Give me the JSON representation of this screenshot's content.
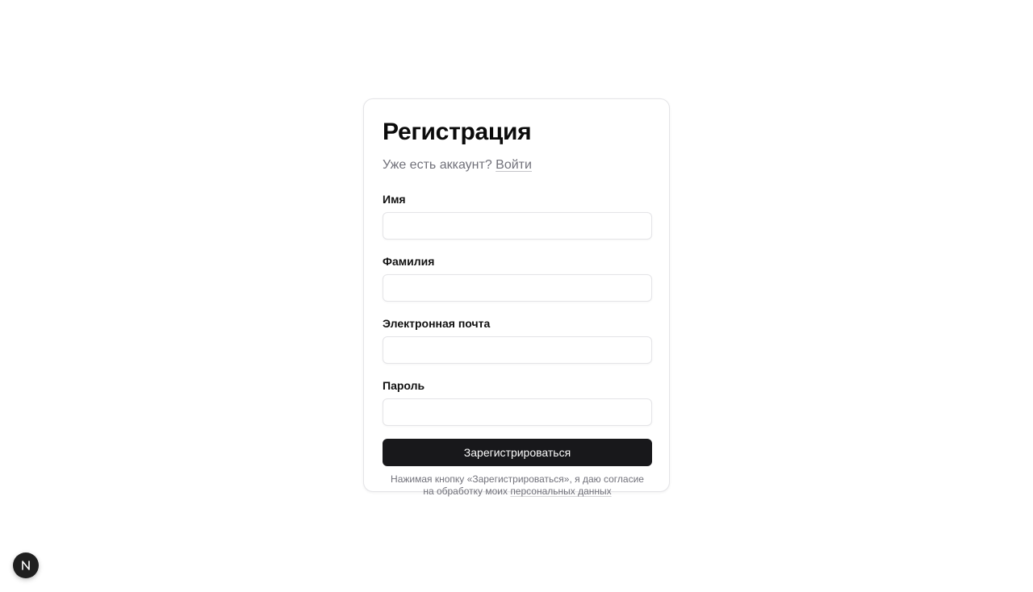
{
  "form": {
    "title": "Регистрация",
    "subtitle_prefix": "Уже есть аккаунт?",
    "login_link": "Войти",
    "fields": [
      {
        "label": "Имя",
        "value": "",
        "placeholder": ""
      },
      {
        "label": "Фамилия",
        "value": "",
        "placeholder": ""
      },
      {
        "label": "Электронная почта",
        "value": "",
        "placeholder": ""
      },
      {
        "label": "Пароль",
        "value": "",
        "placeholder": ""
      }
    ],
    "submit_label": "Зарегистрироваться",
    "consent_line1": "Нажимая кнопку «Зарегистрироваться», я даю согласие",
    "consent_line2_prefix": "на обработку моих",
    "consent_link": "персональных данных"
  },
  "dev_badge": {
    "icon": "nextjs-n-icon",
    "letter": "N"
  },
  "colors": {
    "primary_button": "#18181b",
    "muted_text": "#71717a",
    "border": "#e4e4e7"
  }
}
